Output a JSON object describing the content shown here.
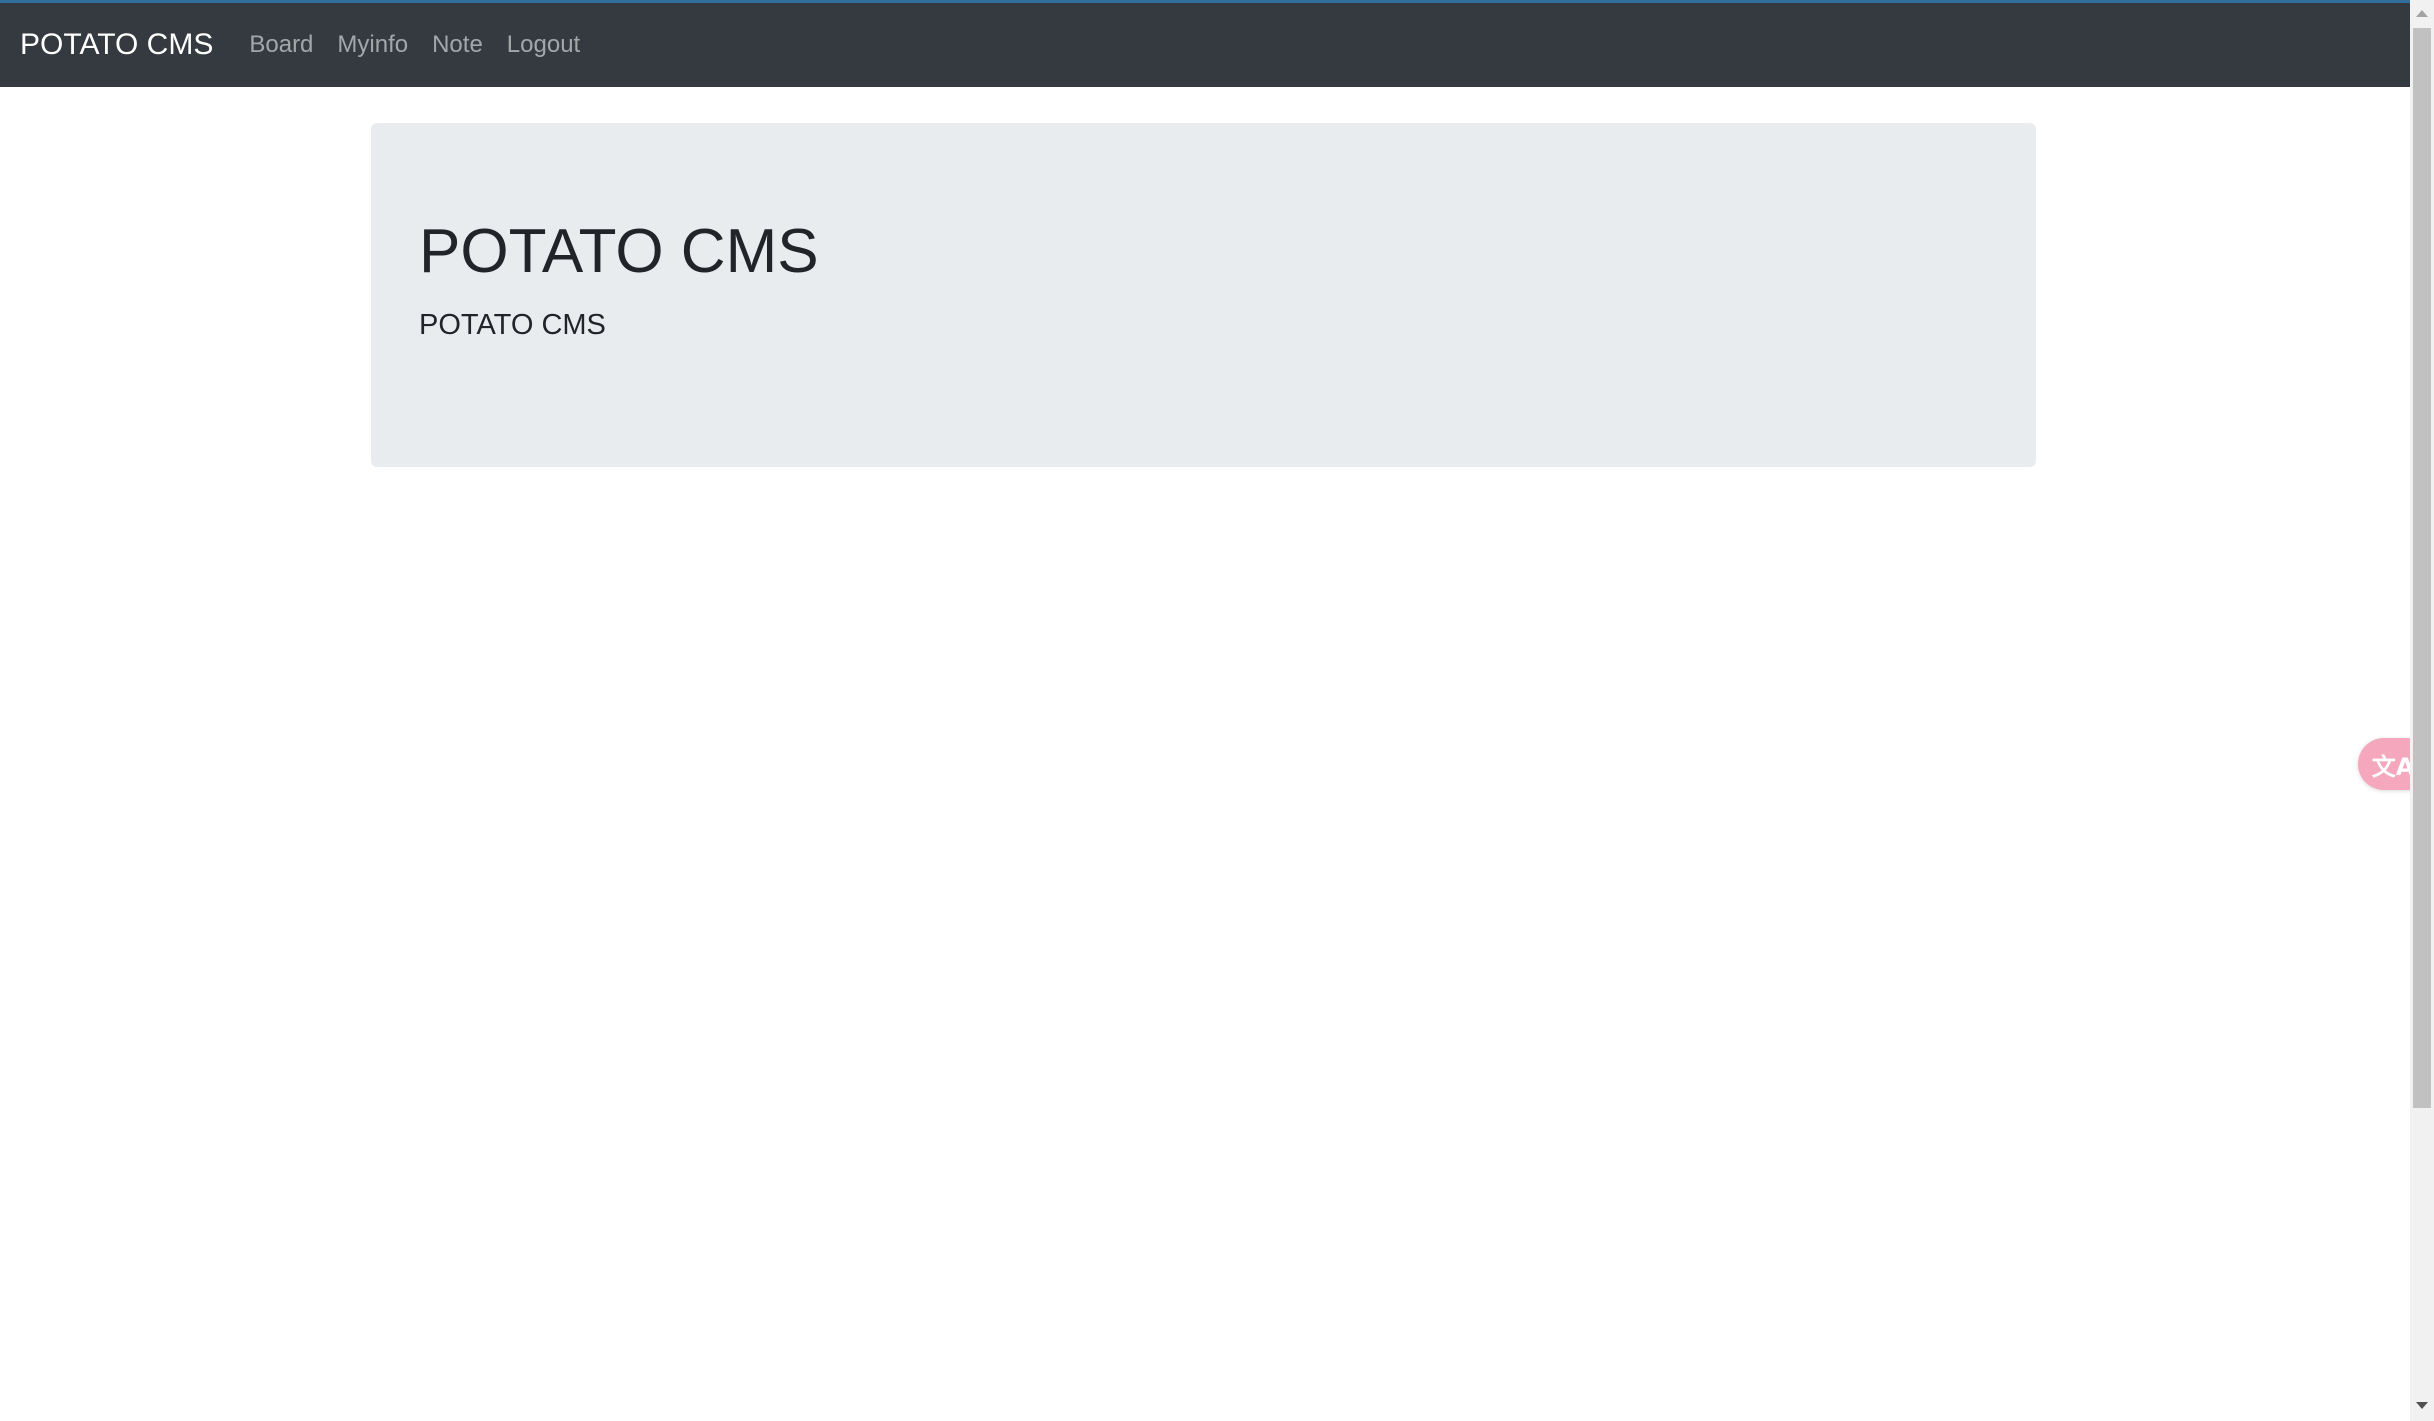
{
  "navbar": {
    "brand": "POTATO CMS",
    "links": [
      "Board",
      "Myinfo",
      "Note",
      "Logout"
    ]
  },
  "jumbotron": {
    "title": "POTATO CMS",
    "lead": "POTATO CMS"
  },
  "translate_widget": {
    "icon": "translate-icon",
    "glyph": "文A",
    "color": "#f4a7bd"
  },
  "colors": {
    "navbar_bg": "#343a40",
    "jumbotron_bg": "#e9ecef",
    "accent": "#2f6f9a"
  }
}
